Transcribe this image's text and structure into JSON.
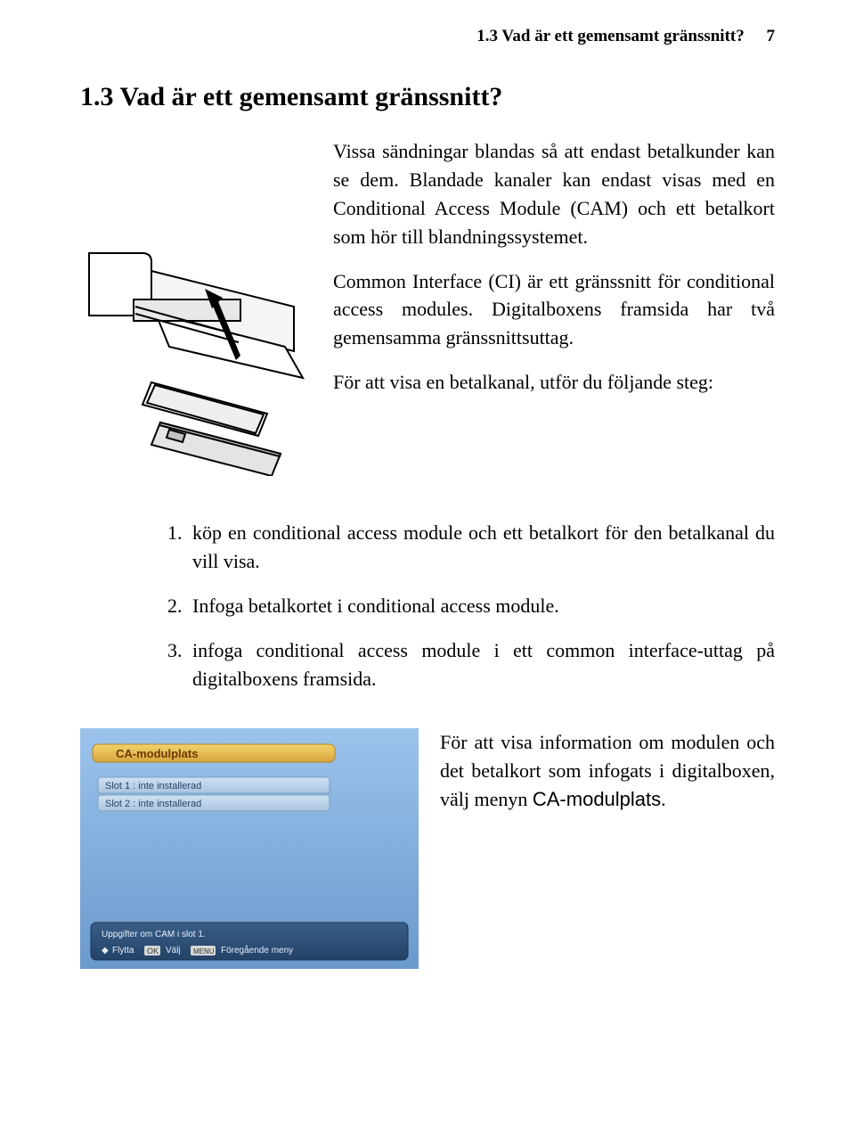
{
  "header": {
    "running_title": "1.3 Vad är ett gemensamt gränssnitt?",
    "page_number": "7"
  },
  "section": {
    "heading": "1.3   Vad är ett gemensamt gränssnitt?",
    "paragraphs": [
      "Vissa sändningar blandas så att endast betalkunder kan se dem. Blandade kanaler kan endast visas med en Conditional Access Module (CAM) och ett betalkort som hör till blandningssystemet.",
      "Common Interface (CI) är ett gränssnitt för conditional access modules. Digitalboxens framsida har två gemensamma gränssnittsuttag.",
      "För att visa en betalkanal, utför du följande steg:"
    ]
  },
  "steps": [
    "köp en conditional access module och ett betalkort för den betalkanal du vill visa.",
    "Infoga betalkortet i conditional access module.",
    "infoga conditional access module i ett common interface-uttag på digitalboxens framsida."
  ],
  "bottom_paragraph": {
    "text_prefix": "För att visa information om modulen och det betalkort som infogats i digitalboxen, välj menyn ",
    "menu_name": "CA-modulplats",
    "text_suffix": "."
  },
  "screenshot_ui": {
    "panel_title": "CA-modulplats",
    "slot1": "Slot 1 : inte installerad",
    "slot2": "Slot 2 : inte installerad",
    "status_line": "Uppgifter om CAM i slot 1.",
    "help_move": "Flytta",
    "help_ok": "OK",
    "help_select": "Välj",
    "help_menu": "MENU",
    "help_back": "Föregående meny"
  }
}
